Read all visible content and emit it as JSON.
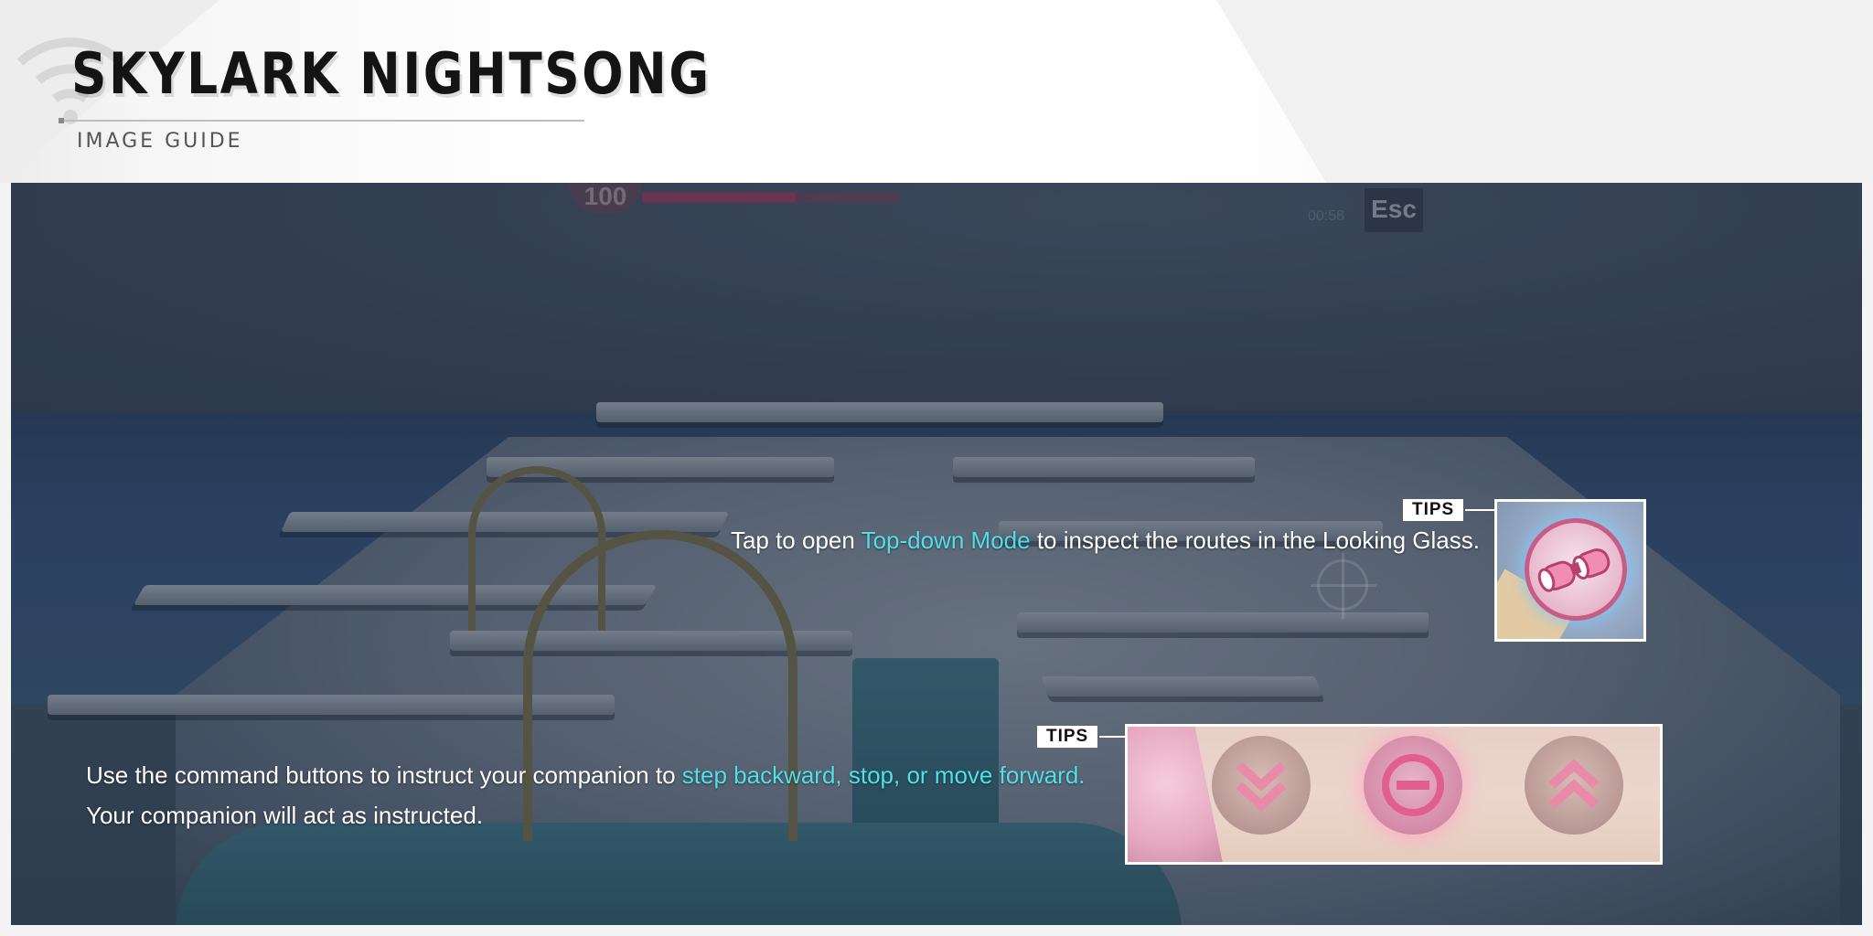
{
  "header": {
    "title": "SKYLARK NIGHTSONG",
    "subtitle": "IMAGE GUIDE"
  },
  "game_hud": {
    "hp_value": "100",
    "timer": "00:58",
    "esc_label": "Esc"
  },
  "tips": [
    {
      "tag": "TIPS",
      "text_before": "Tap to open ",
      "highlight": "Top-down Mode",
      "text_after": " to inspect the routes in the Looking Glass.",
      "icon": "binoculars-icon"
    },
    {
      "tag": "TIPS",
      "line1_before": "Use the command buttons to instruct your companion to ",
      "line1_highlight": "step backward, stop, or move forward.",
      "line2": "Your companion will act as instructed.",
      "icons": [
        "step-backward-icon",
        "stop-icon",
        "move-forward-icon"
      ]
    }
  ],
  "colors": {
    "highlight": "#4fe0e8",
    "tag_background": "#ffffff",
    "button_pink": "#d48aa6"
  }
}
